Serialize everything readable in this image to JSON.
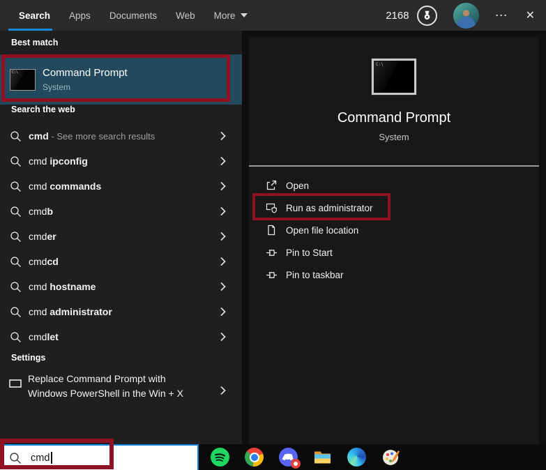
{
  "colors": {
    "accent": "#1a86d9",
    "best_match_highlight": "#23495f",
    "annotation_red": "#8f1122",
    "taskbar_search_border": "#1283da"
  },
  "header": {
    "tabs": [
      "Search",
      "Apps",
      "Documents",
      "Web",
      "More"
    ],
    "rewards_points": "2168",
    "more_options_glyph": "⋯",
    "close_glyph": "✕"
  },
  "left_panel": {
    "best_match_header": "Best match",
    "best_match": {
      "title": "Command Prompt",
      "subtitle": "System"
    },
    "search_web_header": "Search the web",
    "suggestions": [
      {
        "prefix": "",
        "bold": "cmd",
        "suffix": " - See more search results"
      },
      {
        "prefix": "cmd ",
        "bold": "ipconfig",
        "suffix": ""
      },
      {
        "prefix": "cmd ",
        "bold": "commands",
        "suffix": ""
      },
      {
        "prefix": "cmd",
        "bold": "b",
        "suffix": ""
      },
      {
        "prefix": "cmd",
        "bold": "er",
        "suffix": ""
      },
      {
        "prefix": "cmd",
        "bold": "cd",
        "suffix": ""
      },
      {
        "prefix": "cmd ",
        "bold": "hostname",
        "suffix": ""
      },
      {
        "prefix": "cmd ",
        "bold": "administrator",
        "suffix": ""
      },
      {
        "prefix": "cmd",
        "bold": "let",
        "suffix": ""
      }
    ],
    "settings_header": "Settings",
    "settings_item": {
      "line1": "Replace Command Prompt with",
      "line2": "Windows PowerShell in the Win + X"
    }
  },
  "preview_panel": {
    "title": "Command Prompt",
    "subtitle": "System",
    "icon_text": "C:\\",
    "actions": [
      {
        "label": "Open"
      },
      {
        "label": "Run as administrator"
      },
      {
        "label": "Open file location"
      },
      {
        "label": "Pin to Start"
      },
      {
        "label": "Pin to taskbar"
      }
    ]
  },
  "taskbar": {
    "search_value": "cmd",
    "icons": [
      "spotify",
      "chrome",
      "discord",
      "file-explorer",
      "edge",
      "paint-3d"
    ]
  }
}
